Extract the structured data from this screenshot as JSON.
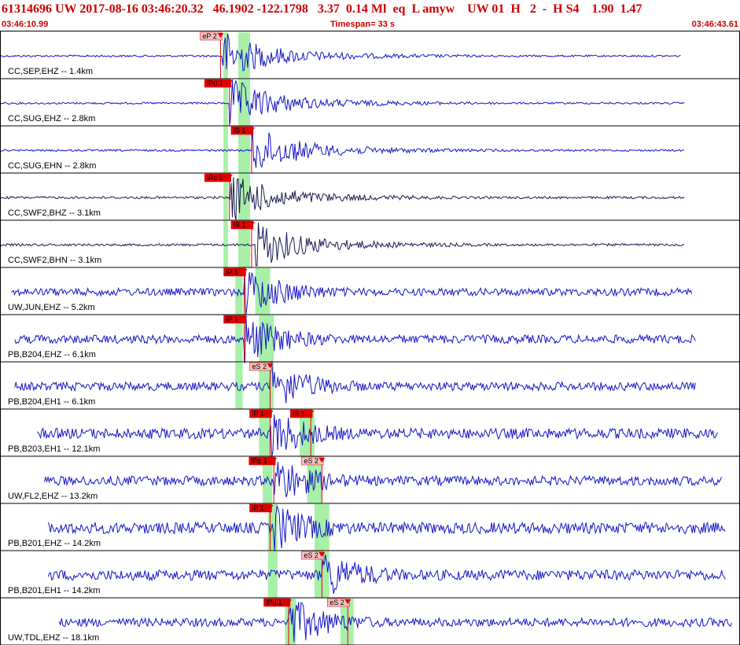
{
  "header": {
    "title": "61314696 UW 2017-08-16 03:46:20.32   46.1902 -122.1798   3.37  0.14 Ml  eq  L amyw    UW 01  H   2  -  H S4    1.90  1.47",
    "start_time": "03:46:10.99",
    "timespan": "Timespan=  33 s",
    "end_time": "03:46:43.61"
  },
  "colors": {
    "trace_blue": "#1414c8",
    "trace_dark": "#1a1a50",
    "pick_red": "#e00000",
    "window_green": "#a8f0a8",
    "header_red": "#cc0000"
  },
  "channels": [
    {
      "label": "CC,SEP,EHZ -- 1.4km",
      "trace_color": "blue",
      "start_frac": 0.0,
      "end_frac": 0.92,
      "onset_frac": 0.3,
      "noise_amp": 0.04,
      "picks": [
        {
          "label": "eP 2",
          "frac": 0.298,
          "primary": false
        }
      ],
      "green": [
        [
          0.302,
          0.308
        ],
        [
          0.322,
          0.338
        ]
      ]
    },
    {
      "label": "CC,SUG,EHZ -- 2.8km",
      "trace_color": "blue",
      "start_frac": 0.0,
      "end_frac": 0.925,
      "onset_frac": 0.31,
      "noise_amp": 0.04,
      "picks": [
        {
          "label": "iPd 1",
          "frac": 0.31,
          "primary": true
        }
      ],
      "green": [
        [
          0.302,
          0.308
        ],
        [
          0.322,
          0.338
        ]
      ]
    },
    {
      "label": "CC,SUG,EHN -- 2.8km",
      "trace_color": "blue",
      "start_frac": 0.0,
      "end_frac": 0.925,
      "onset_frac": 0.34,
      "noise_amp": 0.04,
      "picks": [
        {
          "label": "iS 1",
          "frac": 0.34,
          "primary": true
        }
      ],
      "green": [
        [
          0.302,
          0.308
        ],
        [
          0.322,
          0.338
        ]
      ]
    },
    {
      "label": "CC,SWF2,BHZ -- 3.1km",
      "trace_color": "dark",
      "start_frac": 0.0,
      "end_frac": 0.925,
      "onset_frac": 0.31,
      "noise_amp": 0.05,
      "picks": [
        {
          "label": "iPc 1",
          "frac": 0.31,
          "primary": true
        }
      ],
      "green": [
        [
          0.302,
          0.308
        ],
        [
          0.322,
          0.338
        ]
      ]
    },
    {
      "label": "CC,SWF2,BHN -- 3.1km",
      "trace_color": "dark",
      "start_frac": 0.0,
      "end_frac": 0.925,
      "onset_frac": 0.345,
      "noise_amp": 0.05,
      "picks": [
        {
          "label": "iS 1",
          "frac": 0.34,
          "primary": true
        }
      ],
      "green": [
        [
          0.302,
          0.308
        ],
        [
          0.322,
          0.338
        ]
      ]
    },
    {
      "label": "UW,JUN,EHZ -- 5.2km",
      "trace_color": "blue",
      "start_frac": 0.015,
      "end_frac": 0.935,
      "onset_frac": 0.33,
      "noise_amp": 0.16,
      "picks": [
        {
          "label": "iP 1",
          "frac": 0.33,
          "primary": true
        }
      ],
      "green": [
        [
          0.318,
          0.328
        ],
        [
          0.345,
          0.365
        ]
      ]
    },
    {
      "label": "PB,B204,EHZ -- 6.1km",
      "trace_color": "blue",
      "start_frac": 0.02,
      "end_frac": 0.94,
      "onset_frac": 0.33,
      "noise_amp": 0.18,
      "picks": [
        {
          "label": "iP 1",
          "frac": 0.33,
          "primary": true
        }
      ],
      "green": [
        [
          0.318,
          0.328
        ],
        [
          0.35,
          0.37
        ]
      ]
    },
    {
      "label": "PB,B204,EH1 -- 6.1km",
      "trace_color": "blue",
      "start_frac": 0.02,
      "end_frac": 0.94,
      "onset_frac": 0.365,
      "noise_amp": 0.18,
      "picks": [
        {
          "label": "eS 2",
          "frac": 0.365,
          "primary": false
        }
      ],
      "green": [
        [
          0.318,
          0.328
        ],
        [
          0.35,
          0.37
        ]
      ]
    },
    {
      "label": "PB,B203,EH1 -- 12.1km",
      "trace_color": "blue",
      "start_frac": 0.05,
      "end_frac": 0.97,
      "onset_frac": 0.365,
      "noise_amp": 0.22,
      "picks": [
        {
          "label": "iP 1",
          "frac": 0.365,
          "primary": true
        },
        {
          "label": "iS 1",
          "frac": 0.42,
          "primary": true
        }
      ],
      "green": [
        [
          0.35,
          0.365
        ],
        [
          0.405,
          0.425
        ]
      ]
    },
    {
      "label": "UW,FL2,EHZ -- 13.2km",
      "trace_color": "blue",
      "start_frac": 0.06,
      "end_frac": 0.975,
      "onset_frac": 0.37,
      "noise_amp": 0.2,
      "picks": [
        {
          "label": "iPc 1",
          "frac": 0.37,
          "primary": true
        },
        {
          "label": "eS 2",
          "frac": 0.435,
          "primary": false
        }
      ],
      "green": [
        [
          0.355,
          0.368
        ],
        [
          0.415,
          0.435
        ]
      ]
    },
    {
      "label": "PB,B201,EHZ -- 14.2km",
      "trace_color": "blue",
      "start_frac": 0.065,
      "end_frac": 0.98,
      "onset_frac": 0.37,
      "noise_amp": 0.24,
      "picks": [
        {
          "label": "iP 1",
          "frac": 0.365,
          "primary": true
        }
      ],
      "green": [
        [
          0.362,
          0.375
        ],
        [
          0.425,
          0.445
        ]
      ]
    },
    {
      "label": "PB,B201,EH1 -- 14.2km",
      "trace_color": "blue",
      "start_frac": 0.065,
      "end_frac": 0.98,
      "onset_frac": 0.435,
      "noise_amp": 0.22,
      "picks": [
        {
          "label": "eS 2",
          "frac": 0.435,
          "primary": false
        }
      ],
      "green": [
        [
          0.362,
          0.375
        ],
        [
          0.425,
          0.445
        ]
      ]
    },
    {
      "label": "UW,TDL,EHZ -- 18.1km",
      "trace_color": "blue",
      "start_frac": 0.08,
      "end_frac": 0.99,
      "onset_frac": 0.39,
      "noise_amp": 0.18,
      "picks": [
        {
          "label": "iPd 1",
          "frac": 0.39,
          "primary": true
        },
        {
          "label": "eS 2",
          "frac": 0.47,
          "primary": false
        }
      ],
      "green": [
        [
          0.385,
          0.4
        ],
        [
          0.46,
          0.478
        ]
      ]
    }
  ]
}
